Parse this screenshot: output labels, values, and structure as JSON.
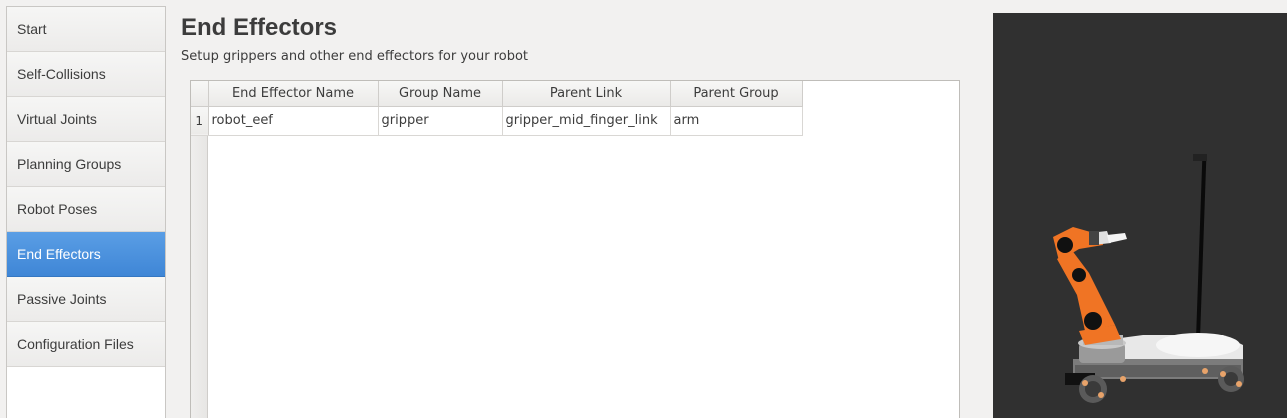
{
  "sidebar": {
    "items": [
      {
        "label": "Start"
      },
      {
        "label": "Self-Collisions"
      },
      {
        "label": "Virtual Joints"
      },
      {
        "label": "Planning Groups"
      },
      {
        "label": "Robot Poses"
      },
      {
        "label": "End Effectors",
        "active": true
      },
      {
        "label": "Passive Joints"
      },
      {
        "label": "Configuration Files"
      }
    ]
  },
  "main": {
    "title": "End Effectors",
    "subtitle": "Setup grippers and other end effectors for your robot"
  },
  "table": {
    "columns": [
      "End Effector Name",
      "Group Name",
      "Parent Link",
      "Parent Group"
    ],
    "rows": [
      {
        "index": "1",
        "cells": [
          "robot_eef",
          "gripper",
          "gripper_mid_finger_link",
          "arm"
        ]
      }
    ]
  },
  "viewer": {
    "background": "#303030",
    "robot_color": "#f07424"
  }
}
